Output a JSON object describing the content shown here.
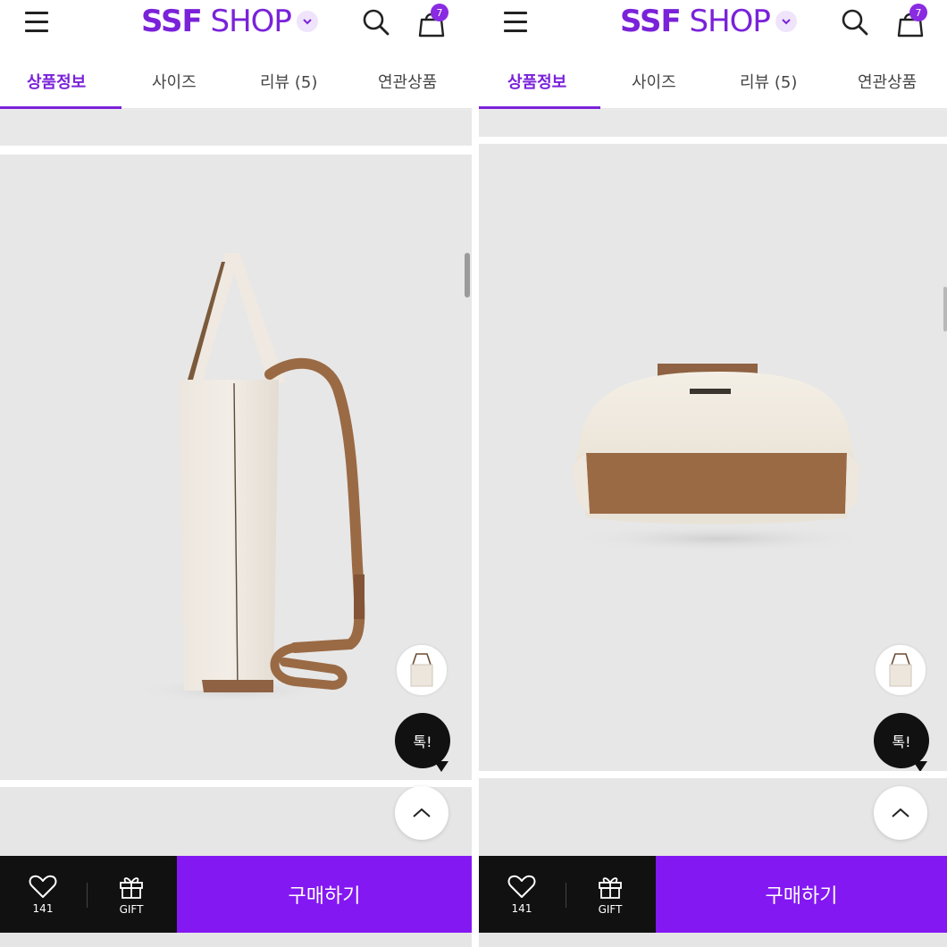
{
  "panels": [
    {
      "header": {
        "logo_bold": "SSF",
        "logo_light": " SHOP",
        "cart_badge": "7"
      },
      "tabs": [
        "상품정보",
        "사이즈",
        "리뷰 (5)",
        "연관상품"
      ],
      "active_tab": 0,
      "talk_label": "톡!",
      "bottom_bar": {
        "wish_count": "141",
        "gift_label": "GIFT",
        "buy_label": "구매하기"
      }
    },
    {
      "header": {
        "logo_bold": "SSF",
        "logo_light": " SHOP",
        "cart_badge": "7"
      },
      "tabs": [
        "상품정보",
        "사이즈",
        "리뷰 (5)",
        "연관상품"
      ],
      "active_tab": 0,
      "talk_label": "톡!",
      "bottom_bar": {
        "wish_count": "141",
        "gift_label": "GIFT",
        "buy_label": "구매하기"
      }
    }
  ],
  "icons": {
    "menu": "hamburger-icon",
    "logo_dropdown": "chevron-down-icon",
    "search": "search-icon",
    "cart": "shopping-bag-icon",
    "thumbnail": "bag-thumbnail",
    "scroll_top": "chevron-up-icon",
    "wish": "heart-icon",
    "gift": "gift-icon"
  },
  "colors": {
    "brand": "#7a22d9",
    "buy_button": "#8418f2",
    "bottom_bar": "#111111",
    "photo_bg": "#e7e7e7"
  }
}
